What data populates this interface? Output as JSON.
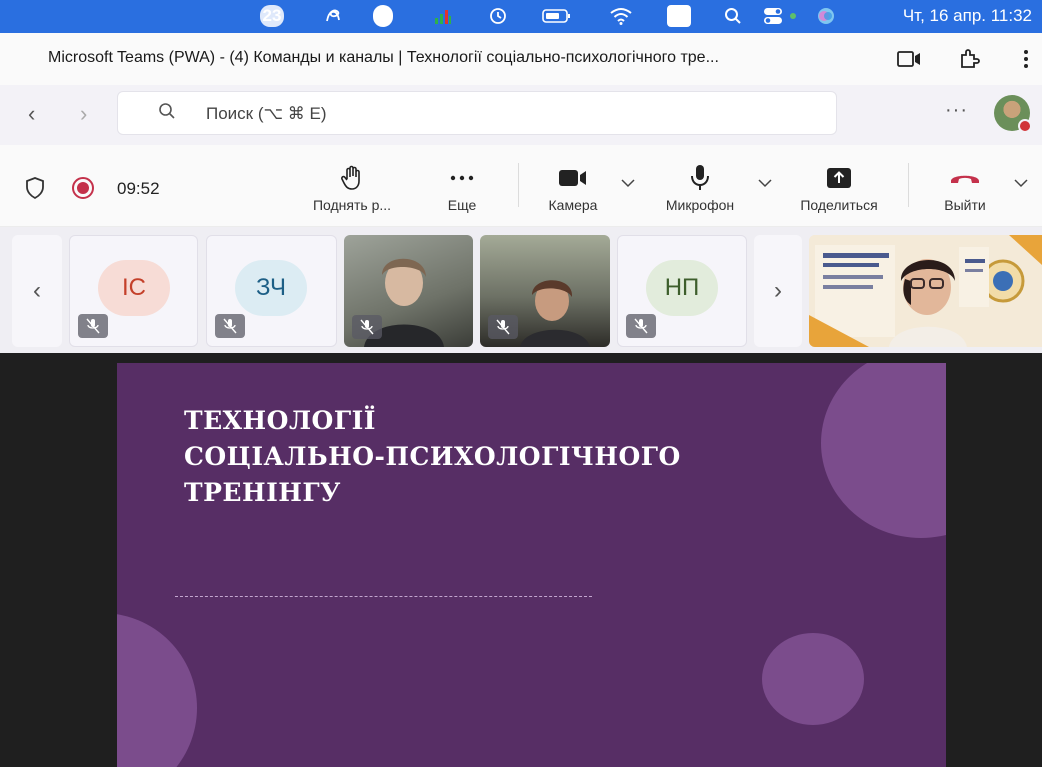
{
  "menubar": {
    "icons": [
      "badge-23",
      "script-icon",
      "m-badge",
      "chart-icon",
      "history-icon",
      "battery-icon",
      "wifi-icon",
      "keyboard-layout-badge",
      "search-icon",
      "control-center-icon",
      "siri-icon"
    ],
    "notification_count": "23",
    "m_label": "M",
    "keyboard_layout": "УК",
    "clock": "Чт, 16 апр.  11:32"
  },
  "titlebar": {
    "title": "Microsoft Teams (PWA) - (4) Команды и каналы | Технології соціально-психологічного тре..."
  },
  "nav": {
    "search_placeholder": "Поиск (⌥ ⌘ E)",
    "more": "···"
  },
  "meeting": {
    "timer": "09:52",
    "raise_hand_label": "Поднять р...",
    "more_label": "Еще",
    "camera_label": "Камера",
    "mic_label": "Микрофон",
    "share_label": "Поделиться",
    "leave_label": "Выйти",
    "colors": {
      "record": "#c4314b",
      "leave": "#c4314b"
    }
  },
  "participants": {
    "tiles": [
      {
        "initials": "ІС",
        "bg": "#f7dcd6",
        "fg": "#c4402a",
        "muted": true
      },
      {
        "initials": "ЗЧ",
        "bg": "#dcecf3",
        "fg": "#1d5f86",
        "muted": true
      },
      {
        "initials": "",
        "video": true,
        "muted": true
      },
      {
        "initials": "",
        "video": true,
        "muted": true
      },
      {
        "initials": "НП",
        "bg": "#e2ecdc",
        "fg": "#3d5e2c",
        "muted": true
      }
    ]
  },
  "slide": {
    "title_line1": "ТЕХНОЛОГІЇ",
    "title_line2": "СОЦІАЛЬНО-ПСИХОЛОГІЧНОГО",
    "title_line3": "ТРЕНІНГУ",
    "bg_color": "#572e65",
    "accent_color": "#7b4c8c"
  }
}
